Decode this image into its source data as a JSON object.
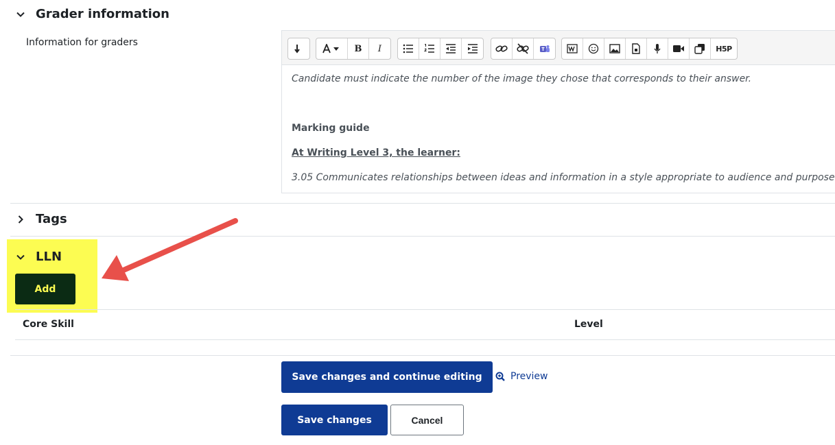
{
  "grader": {
    "section_title": "Grader information",
    "field_label": "Information for graders",
    "toolbar_icons": [
      "collapse-icon",
      "font-color-icon",
      "bold-icon",
      "italic-icon",
      "unordered-list-icon",
      "ordered-list-icon",
      "outdent-icon",
      "indent-icon",
      "link-icon",
      "unlink-icon",
      "teams-icon",
      "word-import-icon",
      "emoji-icon",
      "image-icon",
      "media-file-icon",
      "record-audio-icon",
      "record-video-icon",
      "copy-icon",
      "h5p-icon"
    ],
    "toolbar_labels": {
      "bold": "B",
      "italic": "I",
      "h5p": "H5P"
    },
    "content": {
      "intro": "Candidate must indicate the number of the image they chose that corresponds to their answer.",
      "marking_guide": "Marking guide",
      "level_heading": "At Writing Level 3, the learner:",
      "criterion": "3.05 Communicates relationships between ideas and information in a style appropriate to audience and purpose"
    }
  },
  "tags": {
    "section_title": "Tags"
  },
  "lln": {
    "section_title": "LLN",
    "add_label": "Add",
    "highlight_color": "#fcfc52",
    "add_bg": "#0b2b14",
    "add_fg": "#fcfc52",
    "table": {
      "headers": [
        "Core Skill",
        "Level"
      ]
    }
  },
  "actions": {
    "save_continue": "Save changes and continue editing",
    "preview": "Preview",
    "save": "Save changes",
    "cancel": "Cancel"
  },
  "colors": {
    "primary": "#0f3b94",
    "arrow": "#e8504a",
    "link": "#0f3b94"
  }
}
